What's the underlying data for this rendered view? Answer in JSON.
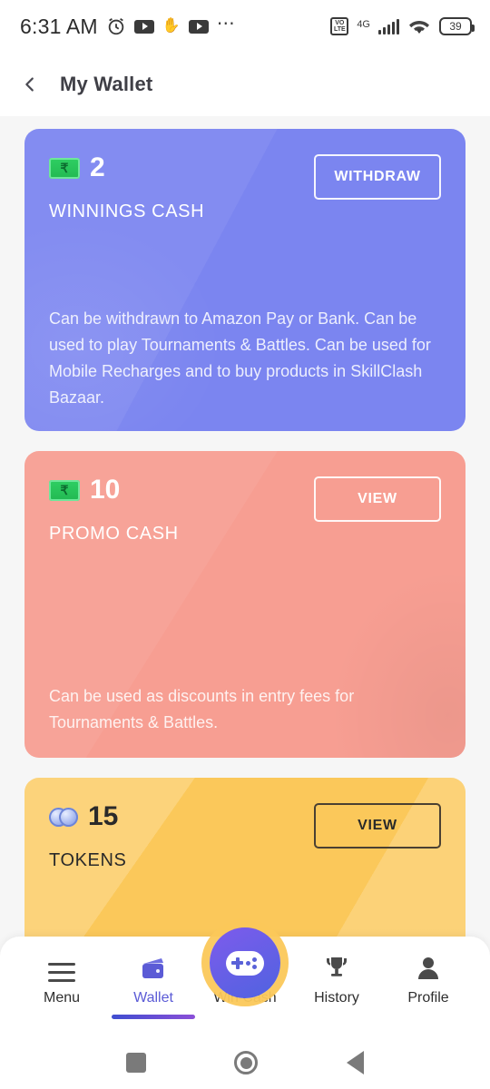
{
  "status_bar": {
    "time": "6:31 AM",
    "notification_icons": [
      "alarm-clock-icon",
      "youtube-icon",
      "hand-icon",
      "youtube-icon",
      "more-dots-icon"
    ],
    "network_type": "4G",
    "battery_percent": "39",
    "right_icons": [
      "volte-icon",
      "signal-bars-icon",
      "wifi-icon",
      "battery-icon"
    ]
  },
  "header": {
    "back_label": "back",
    "title": "My Wallet"
  },
  "cards": [
    {
      "id": "winnings-cash",
      "icon": "rupee-banknote-icon",
      "icon_symbol": "₹",
      "amount": "2",
      "label": "WINNINGS CASH",
      "action_label": "WITHDRAW",
      "description": "Can be withdrawn to Amazon Pay or Bank. Can be used to play Tournaments & Battles. Can be used for Mobile Recharges and to buy products in SkillClash Bazaar.",
      "background_color": "#7b85f0",
      "text_color": "#ffffff"
    },
    {
      "id": "promo-cash",
      "icon": "rupee-banknote-icon",
      "icon_symbol": "₹",
      "amount": "10",
      "label": "PROMO CASH",
      "action_label": "VIEW",
      "description": "Can be used as discounts in entry fees for Tournaments & Battles.",
      "background_color": "#f79e92",
      "text_color": "#ffffff"
    },
    {
      "id": "tokens",
      "icon": "tokens-coins-icon",
      "amount": "15",
      "label": "TOKENS",
      "action_label": "VIEW",
      "description": "",
      "background_color": "#fbc85a",
      "text_color": "#2a2a2a"
    }
  ],
  "bottom_nav": {
    "active": "Wallet",
    "accent_color": "#5b5bd6",
    "items": [
      {
        "label": "Menu",
        "icon": "hamburger-menu-icon"
      },
      {
        "label": "Wallet",
        "icon": "wallet-icon"
      },
      {
        "label": "Win Cash",
        "icon": "gamepad-icon"
      },
      {
        "label": "History",
        "icon": "trophy-icon"
      },
      {
        "label": "Profile",
        "icon": "person-icon"
      }
    ]
  },
  "android_nav": {
    "recents": "recents-button",
    "home": "home-button",
    "back": "back-button"
  }
}
